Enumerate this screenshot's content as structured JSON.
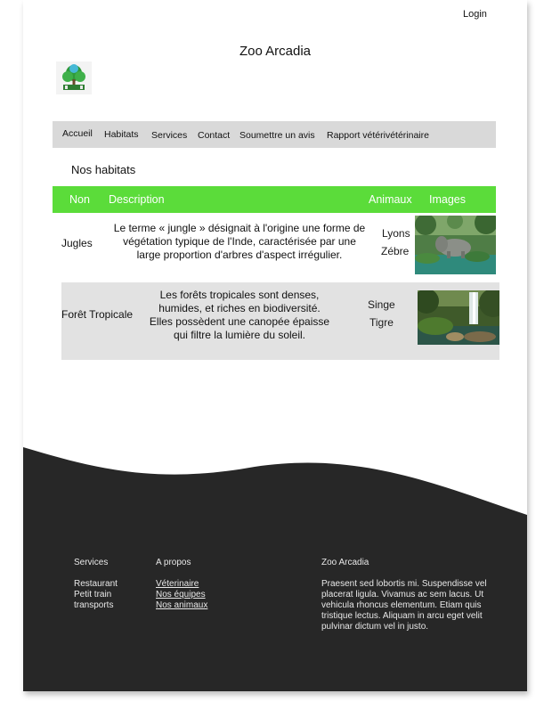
{
  "header": {
    "login_label": "Login",
    "site_title": "Zoo Arcadia"
  },
  "nav": {
    "items": [
      {
        "label": "Accueil"
      },
      {
        "label": "Habitats"
      },
      {
        "label": "Services"
      },
      {
        "label": "Contact"
      },
      {
        "label": "Soumettre un avis"
      },
      {
        "label": "Rapport vétérivétérinaire"
      }
    ]
  },
  "section": {
    "title": "Nos habitats"
  },
  "table": {
    "columns": [
      "Non",
      "Description",
      "Animaux",
      "Images"
    ],
    "rows": [
      {
        "name": "Jugles",
        "description": "Le terme « jungle » désignait à l'origine une forme de végétation typique de l'Inde, caractérisée par une large proportion d'arbres d'aspect irrégulier.",
        "animals": [
          "Lyons",
          "Zébre"
        ]
      },
      {
        "name": "Forêt Tropicale",
        "description": "Les forêts tropicales sont denses, humides, et riches en biodiversité. Elles possèdent une canopée épaisse qui filtre la lumière du soleil.",
        "animals": [
          "Singe",
          "Tigre"
        ]
      }
    ]
  },
  "footer": {
    "services_title": "Services",
    "services_items": [
      "Restaurant",
      "Petit train",
      "transports"
    ],
    "about_title": "A propos",
    "about_links": [
      "Véterinaire",
      "Nos équipes",
      "Nos animaux"
    ],
    "zoo_title": "Zoo Arcadia",
    "zoo_text": "Praesent sed lobortis mi. Suspendisse vel placerat ligula. Vivamus ac sem lacus. Ut vehicula rhoncus elementum. Etiam quis tristique lectus. Aliquam in arcu eget velit pulvinar dictum vel in justo."
  },
  "colors": {
    "nav_bg": "#d9d9d9",
    "table_header_bg": "#5bdc3a",
    "row_alt_bg": "#e2e2e2",
    "footer_bg": "#272727"
  }
}
